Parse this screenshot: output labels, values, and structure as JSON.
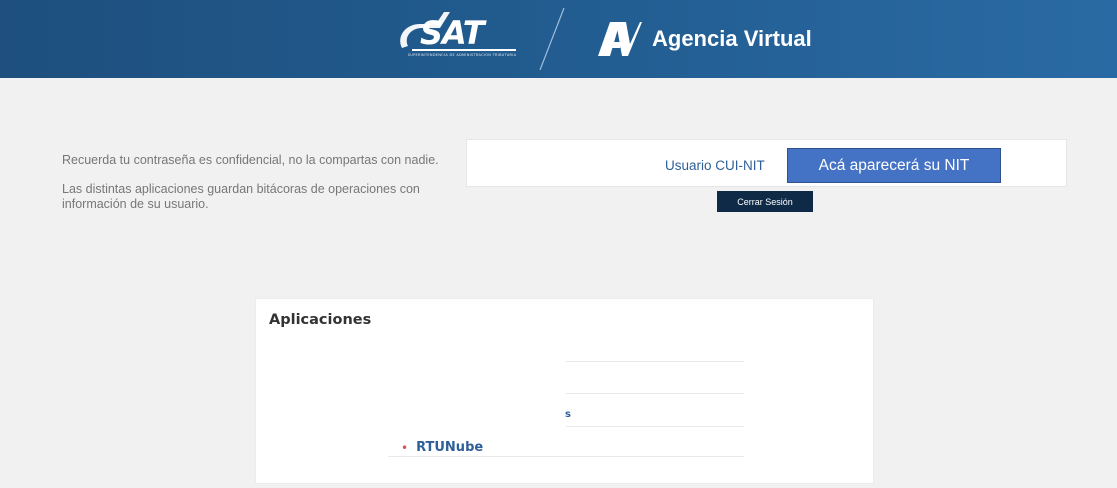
{
  "header": {
    "logo_text": "SAT",
    "logo_subtitle": "SUPERINTENDENCIA DE ADMINISTRACIÓN TRIBUTARIA",
    "app_title": "Agencia Virtual",
    "colors": {
      "bar": "#215b8e",
      "text": "#ffffff"
    }
  },
  "info": {
    "line1": "Recuerda tu contraseña es confidencial, no la compartas con nadie.",
    "line2": "Las distintas aplicaciones guardan bitácoras de operaciones con información de su usuario."
  },
  "user": {
    "label": "Usuario CUI-NIT",
    "nit_placeholder": "Acá aparecerá su NIT",
    "logout_label": "Cerrar Sesión",
    "colors": {
      "nit_box": "#4472c4",
      "logout_button": "#0e2a47"
    }
  },
  "apps": {
    "title": "Aplicaciones",
    "partial_char": "s",
    "items": [
      {
        "label": "RTUNube",
        "icon": "bullet-dot-icon",
        "bullet_color": "#d9534f"
      }
    ]
  }
}
